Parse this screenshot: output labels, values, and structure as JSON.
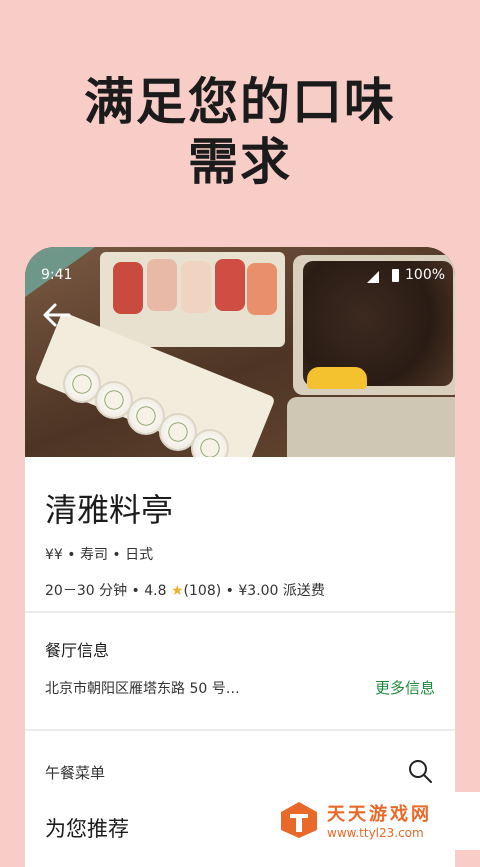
{
  "promo": {
    "line1": "满足您的口味",
    "line2": "需求"
  },
  "status_bar": {
    "time": "9:41",
    "battery": "100%"
  },
  "restaurant": {
    "name": "清雅料亭",
    "categories": "¥¥ • 寿司 • 日式",
    "delivery_time": "20－30 分钟",
    "rating": "4.8",
    "reviews": "(108)",
    "delivery_fee": "¥3.00 派送费",
    "separator": "•"
  },
  "info_section": {
    "title": "餐厅信息",
    "address": "北京市朝阳区雁塔东路 50 号…",
    "more_label": "更多信息"
  },
  "menu": {
    "label": "午餐菜单",
    "recommend_title": "为您推荐"
  },
  "watermark": {
    "name": "天天游戏网",
    "url": "www.ttyl23.com"
  },
  "colors": {
    "background": "#f8cdc7",
    "accent_green": "#1f8a3b",
    "star": "#e9b22a",
    "watermark": "#e9692a"
  },
  "icons": [
    "back-arrow-icon",
    "signal-icon",
    "battery-icon",
    "star-icon",
    "search-icon"
  ]
}
